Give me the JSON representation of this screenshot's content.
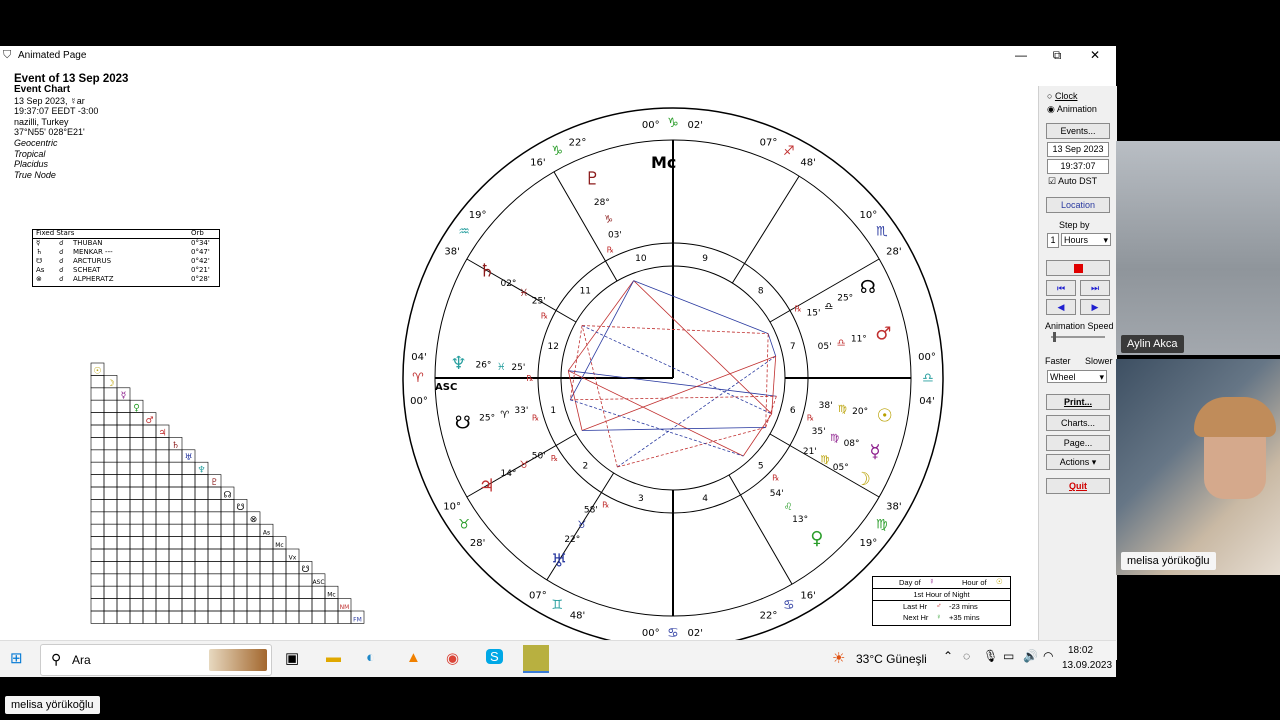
{
  "window": {
    "title": "Animated Page",
    "minimize": "—",
    "restore": "⧉",
    "close": "✕"
  },
  "info": {
    "title": "Event of 13 Sep 2023",
    "chart_type": "Event Chart",
    "date_line": "13 Sep 2023, ☿ar",
    "time_line": "19:37:07  EEDT -3:00",
    "place": "nazilli, Turkey",
    "coords": "37°N55' 028°E21'",
    "settings": [
      "Geocentric",
      "Tropical",
      "Placidus",
      "True Node"
    ]
  },
  "fixed_stars": {
    "headers": [
      "Fixed Stars",
      "Orb"
    ],
    "rows": [
      {
        "planet": "☿",
        "aspect": "☌",
        "name": "THUBAN",
        "orb": "0°34'"
      },
      {
        "planet": "♄",
        "aspect": "☌",
        "name": "MENKAR ---",
        "orb": "0°47'"
      },
      {
        "planet": "☋",
        "aspect": "☌",
        "name": "ARCTURUS",
        "orb": "0°42'"
      },
      {
        "planet": "As",
        "aspect": "☌",
        "name": "SCHEAT",
        "orb": "0°21'"
      },
      {
        "planet": "⊗",
        "aspect": "☌",
        "name": "ALPHERATZ",
        "orb": "0°28'"
      }
    ]
  },
  "wheel": {
    "mc_label": "Mc",
    "asc_label": "ASC",
    "outer_labels": [
      {
        "t": "00°",
        "a": 95
      },
      {
        "t": "♑",
        "a": 90,
        "c": "#2a9d2a"
      },
      {
        "t": "02'",
        "a": 85
      },
      {
        "t": "07°",
        "a": 68
      },
      {
        "t": "♐",
        "a": 63,
        "c": "#c03030"
      },
      {
        "t": "48'",
        "a": 58
      },
      {
        "t": "10°",
        "a": 40
      },
      {
        "t": "♏",
        "a": 35,
        "c": "#2a3aa0"
      },
      {
        "t": "28'",
        "a": 30
      },
      {
        "t": "00°",
        "a": 5
      },
      {
        "t": "♎",
        "a": 0,
        "c": "#2aa0a0"
      },
      {
        "t": "04'",
        "a": -5
      },
      {
        "t": "38'",
        "a": -30
      },
      {
        "t": "♍",
        "a": -35,
        "c": "#2a9d2a"
      },
      {
        "t": "19°",
        "a": -40
      },
      {
        "t": "16'",
        "a": -58
      },
      {
        "t": "♋",
        "a": -63,
        "c": "#2a3aa0"
      },
      {
        "t": "22°",
        "a": -68
      },
      {
        "t": "02'",
        "a": -85
      },
      {
        "t": "♋",
        "a": -90,
        "c": "#2a3aa0"
      },
      {
        "t": "00°",
        "a": -95
      },
      {
        "t": "48'",
        "a": -112
      },
      {
        "t": "♊",
        "a": -117,
        "c": "#2aa0a0"
      },
      {
        "t": "07°",
        "a": -122
      },
      {
        "t": "28'",
        "a": -140
      },
      {
        "t": "♉",
        "a": -145,
        "c": "#2a9d2a"
      },
      {
        "t": "10°",
        "a": -150
      },
      {
        "t": "04'",
        "a": 175
      },
      {
        "t": "♈",
        "a": 180,
        "c": "#c03030"
      },
      {
        "t": "00°",
        "a": 185
      },
      {
        "t": "19°",
        "a": 140
      },
      {
        "t": "♒",
        "a": 145,
        "c": "#2aa0a0"
      },
      {
        "t": "38'",
        "a": 150
      },
      {
        "t": "22°",
        "a": 112
      },
      {
        "t": "♑",
        "a": 117,
        "c": "#2a9d2a"
      },
      {
        "t": "16'",
        "a": 122
      }
    ],
    "house_numbers": [
      "1",
      "2",
      "3",
      "4",
      "5",
      "6",
      "7",
      "8",
      "9",
      "10",
      "11",
      "12"
    ],
    "planets": [
      {
        "g": "♇",
        "c": "#8b1a1a",
        "deg": "28°",
        "sign": "♑",
        "min": "03'",
        "r": "℞",
        "a": 112
      },
      {
        "g": "♅",
        "c": "#2a3aa0",
        "deg": "22°",
        "sign": "♉",
        "min": "58'",
        "r": "℞",
        "a": -122
      },
      {
        "g": "♆",
        "c": "#2aa0a0",
        "deg": "26°",
        "sign": "♓",
        "min": "25'",
        "r": "℞",
        "a": 176
      },
      {
        "g": "♄",
        "c": "#8b1a1a",
        "deg": "02°",
        "sign": "♓",
        "min": "25'",
        "r": "℞",
        "a": 150
      },
      {
        "g": "♃",
        "c": "#c03030",
        "deg": "14°",
        "sign": "♉",
        "min": "50'",
        "r": "℞",
        "a": -150
      },
      {
        "g": "☋",
        "c": "#000000",
        "deg": "25°",
        "sign": "♈",
        "min": "33'",
        "r": "℞",
        "a": -168
      },
      {
        "g": "♂",
        "c": "#c03030",
        "deg": "11°",
        "sign": "♎",
        "min": "05'",
        "r": "",
        "a": 12
      },
      {
        "g": "☉",
        "c": "#b8a000",
        "deg": "20°",
        "sign": "♍",
        "min": "38'",
        "r": "",
        "a": -10
      },
      {
        "g": "☿",
        "c": "#8b1a8b",
        "deg": "08°",
        "sign": "♍",
        "min": "35'",
        "r": "℞",
        "a": -20
      },
      {
        "g": "☽",
        "c": "#b8a000",
        "deg": "05°",
        "sign": "♍",
        "min": "21'",
        "r": "",
        "a": -28
      },
      {
        "g": "♀",
        "c": "#2a9d2a",
        "deg": "13°",
        "sign": "♌",
        "min": "54'",
        "r": "℞",
        "a": -48
      },
      {
        "g": "☊",
        "c": "#000000",
        "deg": "25°",
        "sign": "♎",
        "min": "15'",
        "r": "℞",
        "a": 25
      }
    ]
  },
  "hour_box": {
    "day_of": "Day of",
    "hour_of": "Hour of",
    "title": "1st Hour of Night",
    "last_label": "Last Hr",
    "last_val": "-23 mins",
    "next_label": "Next Hr",
    "next_val": "+35 mins"
  },
  "panel": {
    "radio_clock": "Clock",
    "radio_animation": "Animation",
    "events_btn": "Events...",
    "date": "13 Sep 2023",
    "time": "19:37:07",
    "auto_dst": "Auto DST",
    "location_btn": "Location",
    "step_by": "Step by",
    "step_value": "1",
    "step_unit": "Hours",
    "animation_speed": "Animation Speed",
    "faster": "Faster",
    "slower": "Slower",
    "mode": "Wheel",
    "print_btn": "Print...",
    "charts_btn": "Charts...",
    "page_btn": "Page...",
    "actions_btn": "Actions",
    "quit_btn": "Quit"
  },
  "taskbar": {
    "search": "Ara",
    "weather": "33°C  Güneşli",
    "clock_time": "18:02",
    "clock_date": "13.09.2023"
  },
  "participants": {
    "top": "Aylin Akca",
    "bottom": "melisa yörükoğlu",
    "main": "melisa yörükoğlu"
  }
}
